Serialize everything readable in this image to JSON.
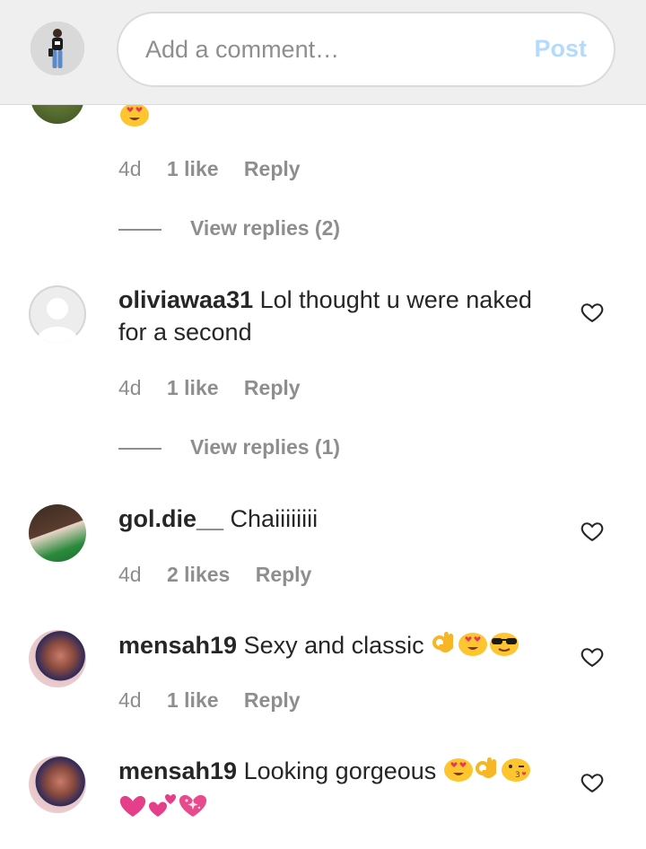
{
  "header": {
    "comment_placeholder": "Add a comment…",
    "post_label": "Post"
  },
  "comments": [
    {
      "time": "4d",
      "likes": "1 like",
      "reply": "Reply",
      "view_replies": "View replies (2)"
    },
    {
      "username": "oliviawaa31",
      "text": "Lol thought u were naked for a second",
      "time": "4d",
      "likes": "1 like",
      "reply": "Reply",
      "view_replies": "View replies (1)"
    },
    {
      "username": "gol.die__",
      "text": "Chaiiiiiiii",
      "time": "4d",
      "likes": "2 likes",
      "reply": "Reply"
    },
    {
      "username": "mensah19",
      "text": "Sexy and classic",
      "emojis": [
        "ok-hand",
        "heart-eyes",
        "sunglasses-face"
      ],
      "time": "4d",
      "likes": "1 like",
      "reply": "Reply"
    },
    {
      "username": "mensah19",
      "text": "Looking gorgeous",
      "emojis": [
        "heart-eyes",
        "ok-hand",
        "kissing-wink",
        "heart",
        "two-hearts",
        "sparkling-heart"
      ]
    }
  ],
  "colors": {
    "header_bg": "#efefef",
    "post_disabled": "#b3dbff",
    "muted_text": "#8e8e8e",
    "text": "#262626"
  }
}
